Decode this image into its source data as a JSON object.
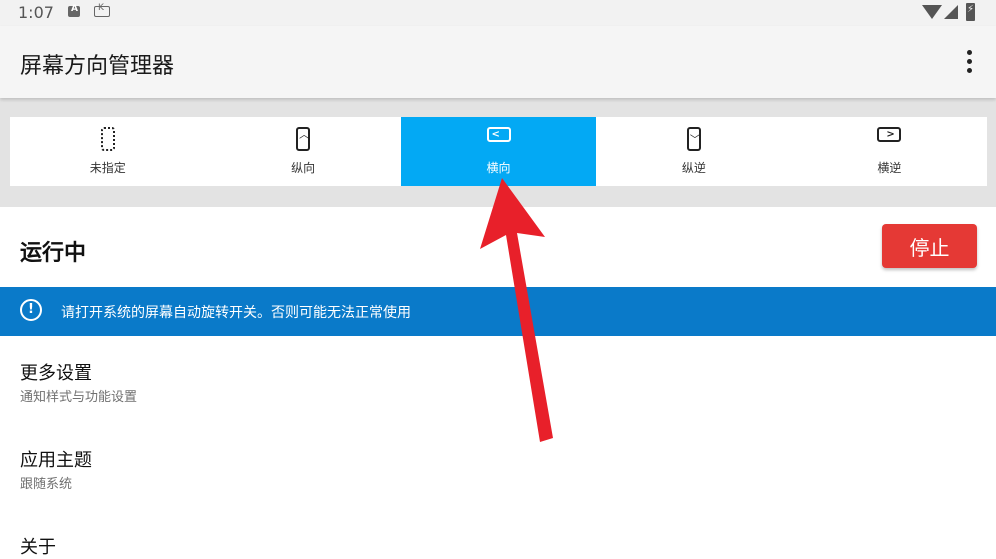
{
  "status_bar": {
    "time": "1:07",
    "icon_a": "A",
    "icon_b": "K"
  },
  "app_bar": {
    "title": "屏幕方向管理器",
    "menu_icon": "more-vert-icon"
  },
  "orientation_tabs": [
    {
      "label": "未指定",
      "icon": "phone-dotted-icon"
    },
    {
      "label": "纵向",
      "icon": "portrait-icon"
    },
    {
      "label": "横向",
      "icon": "landscape-icon",
      "selected": true
    },
    {
      "label": "纵逆",
      "icon": "reverse-portrait-icon"
    },
    {
      "label": "横逆",
      "icon": "reverse-landscape-icon"
    }
  ],
  "status": {
    "label": "运行中",
    "stop_button": "停止"
  },
  "notice": {
    "text": "请打开系统的屏幕自动旋转开关。否则可能无法正常使用",
    "icon": "exclamation-icon"
  },
  "settings": [
    {
      "title": "更多设置",
      "subtitle": "通知样式与功能设置"
    },
    {
      "title": "应用主题",
      "subtitle": "跟随系统"
    },
    {
      "title": "关于",
      "subtitle": ""
    }
  ],
  "colors": {
    "accent": "#03a9f4",
    "notice": "#0a7ac9",
    "stop": "#e53935",
    "arrow": "#e8202a"
  }
}
